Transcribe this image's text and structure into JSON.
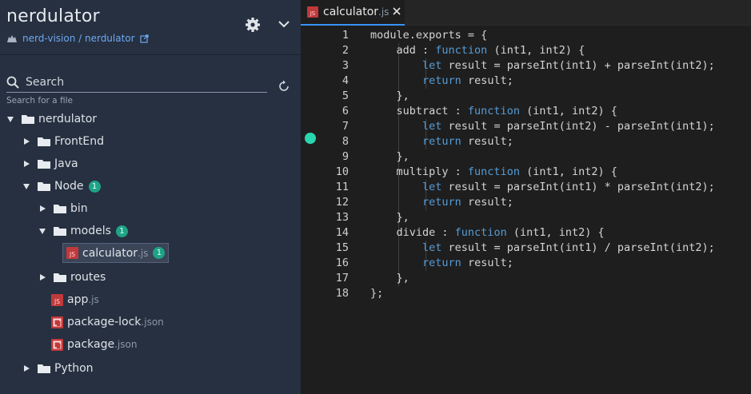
{
  "sidebar": {
    "title": "nerdulator",
    "repo_link": "nerd-vision / nerdulator",
    "search_label": "Search",
    "search_hint": "Search for a file",
    "tree": [
      {
        "label": "nerdulator",
        "ext": "",
        "type": "folder",
        "expanded": true,
        "badge": ""
      },
      {
        "label": "FrontEnd",
        "ext": "",
        "type": "folder",
        "expanded": false,
        "badge": ""
      },
      {
        "label": "Java",
        "ext": "",
        "type": "folder",
        "expanded": false,
        "badge": ""
      },
      {
        "label": "Node",
        "ext": "",
        "type": "folder",
        "expanded": true,
        "badge": "1"
      },
      {
        "label": "bin",
        "ext": "",
        "type": "folder",
        "expanded": false,
        "badge": ""
      },
      {
        "label": "models",
        "ext": "",
        "type": "folder",
        "expanded": true,
        "badge": "1"
      },
      {
        "label": "calculator",
        "ext": ".js",
        "type": "js",
        "selected": true,
        "badge": "1"
      },
      {
        "label": "routes",
        "ext": "",
        "type": "folder",
        "expanded": false,
        "badge": ""
      },
      {
        "label": "app",
        "ext": ".js",
        "type": "js",
        "badge": ""
      },
      {
        "label": "package-lock",
        "ext": ".json",
        "type": "json",
        "badge": ""
      },
      {
        "label": "package",
        "ext": ".json",
        "type": "json",
        "badge": ""
      },
      {
        "label": "Python",
        "ext": "",
        "type": "folder",
        "expanded": false,
        "badge": ""
      }
    ]
  },
  "editor": {
    "tab": {
      "name": "calculator",
      "ext": ".js"
    },
    "breakpoint_line": 8,
    "accent": "#2ad6b0",
    "lines": [
      "module.exports = {",
      "    add : function (int1, int2) {",
      "        let result = parseInt(int1) + parseInt(int2);",
      "        return result;",
      "    },",
      "    subtract : function (int1, int2) {",
      "        let result = parseInt(int2) - parseInt(int1);",
      "        return result;",
      "    },",
      "    multiply : function (int1, int2) {",
      "        let result = parseInt(int1) * parseInt(int2);",
      "        return result;",
      "    },",
      "    divide : function (int1, int2) {",
      "        let result = parseInt(int1) / parseInt(int2);",
      "        return result;",
      "    },",
      "};"
    ]
  },
  "icons": {
    "search": "search-icon",
    "settings": "gear-icon",
    "collapse": "chevron-down-icon",
    "refresh": "refresh-icon",
    "close": "close-icon",
    "github": "github-icon",
    "external": "external-link-icon"
  }
}
